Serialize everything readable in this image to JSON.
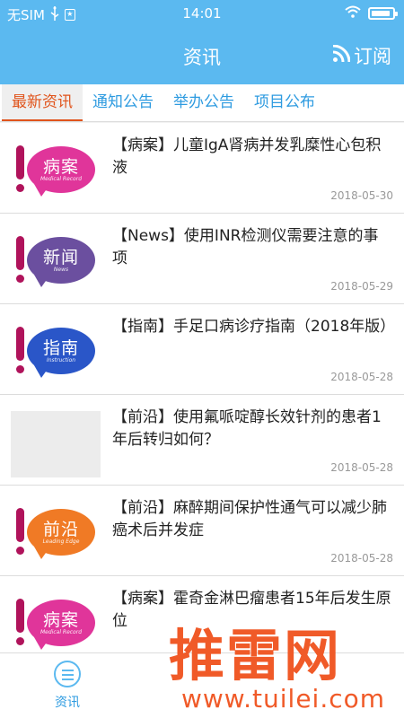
{
  "status_bar": {
    "carrier": "无SIM",
    "time": "14:01"
  },
  "header": {
    "title": "资讯",
    "subscribe_label": "订阅"
  },
  "tabs": [
    {
      "label": "最新资讯",
      "active": true
    },
    {
      "label": "通知公告",
      "active": false
    },
    {
      "label": "举办公告",
      "active": false
    },
    {
      "label": "项目公布",
      "active": false
    }
  ],
  "news": [
    {
      "title": "【病案】儿童IgA肾病并发乳糜性心包积液",
      "date": "2018-05-30",
      "thumb": {
        "type": "case-badge",
        "text": "病案",
        "sub": "Medical Record",
        "color": "#e0359a"
      }
    },
    {
      "title": "【News】使用INR检测仪需要注意的事项",
      "date": "2018-05-29",
      "thumb": {
        "type": "news-badge",
        "text": "新闻",
        "sub": "News",
        "color": "#6b4f9f"
      }
    },
    {
      "title": "【指南】手足口病诊疗指南（2018年版）",
      "date": "2018-05-28",
      "thumb": {
        "type": "guide-badge",
        "text": "指南",
        "sub": "Instruction",
        "color": "#2a56c8"
      }
    },
    {
      "title": "【前沿】使用氟哌啶醇长效针剂的患者1年后转归如何？",
      "date": "2018-05-28",
      "thumb": {
        "type": "blank"
      }
    },
    {
      "title": "【前沿】麻醉期间保护性通气可以减少肺癌术后并发症",
      "date": "2018-05-28",
      "thumb": {
        "type": "frontier-badge",
        "text": "前沿",
        "sub": "Leading Edge",
        "color": "#f07a25"
      }
    },
    {
      "title": "【病案】霍奇金淋巴瘤患者15年后发生原位",
      "date": "",
      "thumb": {
        "type": "case-badge",
        "text": "病案",
        "sub": "Medical Record",
        "color": "#e0359a"
      }
    }
  ],
  "bottom_nav": {
    "label": "资讯"
  },
  "watermark": {
    "main": "推雷网",
    "url": "www.tuilei.com"
  },
  "colors": {
    "primary": "#5bb9f0",
    "active_tab": "#e0541c",
    "tab_text": "#2e9be0",
    "watermark": "#f05a28",
    "exclamation": "#b0135b"
  }
}
